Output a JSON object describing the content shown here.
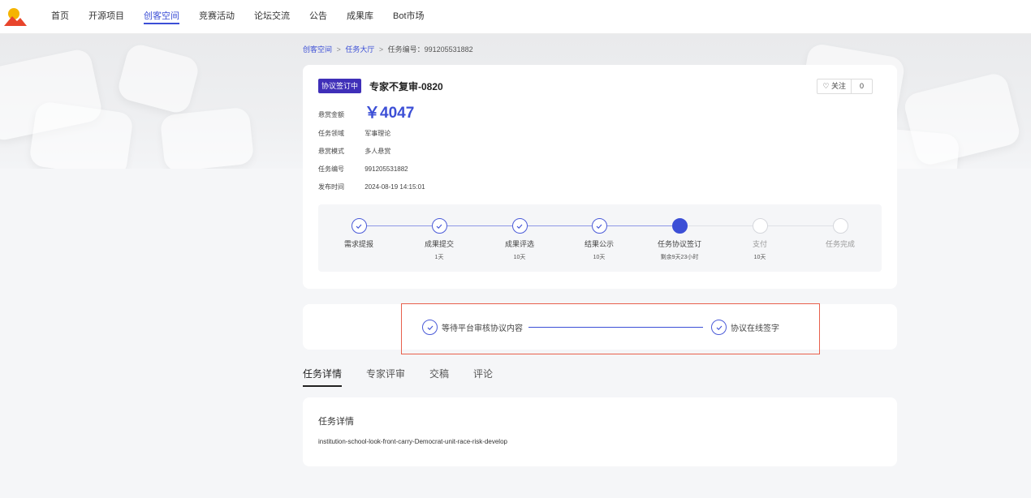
{
  "nav": {
    "items": [
      "首页",
      "开源项目",
      "创客空间",
      "竞赛活动",
      "论坛交流",
      "公告",
      "成果库",
      "Bot市场"
    ],
    "active_index": 2
  },
  "breadcrumb": {
    "item1": "创客空间",
    "item2": "任务大厅",
    "current": "任务编号：991205531882",
    "separator": ">"
  },
  "task": {
    "status_tag": "协议签订中",
    "title": "专家不复审-0820",
    "follow_label": "关注",
    "follow_count": "0",
    "reward_label": "悬赏金额",
    "reward_amount": "￥4047",
    "domain_label": "任务领域",
    "domain_value": "军事理论",
    "mode_label": "悬赏模式",
    "mode_value": "多人悬赏",
    "id_label": "任务编号",
    "id_value": "991205531882",
    "time_label": "发布时间",
    "time_value": "2024-08-19 14:15:01"
  },
  "progress": {
    "steps": [
      {
        "name": "需求提报",
        "sub": "",
        "state": "done"
      },
      {
        "name": "成果提交",
        "sub": "1天",
        "state": "done"
      },
      {
        "name": "成果评选",
        "sub": "10天",
        "state": "done"
      },
      {
        "name": "结果公示",
        "sub": "10天",
        "state": "done"
      },
      {
        "name": "任务协议签订",
        "sub": "剩余9天23小时",
        "state": "current"
      },
      {
        "name": "支付",
        "sub": "10天",
        "state": "todo"
      },
      {
        "name": "任务完成",
        "sub": "",
        "state": "todo"
      }
    ]
  },
  "agreement": {
    "step1": "等待平台审核协议内容",
    "step2": "协议在线签字"
  },
  "tabs": [
    "任务详情",
    "专家评审",
    "交稿",
    "评论"
  ],
  "detail": {
    "title": "任务详情",
    "text": "institution-school-look-front-carry-Democrat-unit-race-risk-develop"
  },
  "colors": {
    "accent": "#3c4fd6",
    "status_tag": "#3f2fb8",
    "highlight_border": "#e8604c"
  }
}
